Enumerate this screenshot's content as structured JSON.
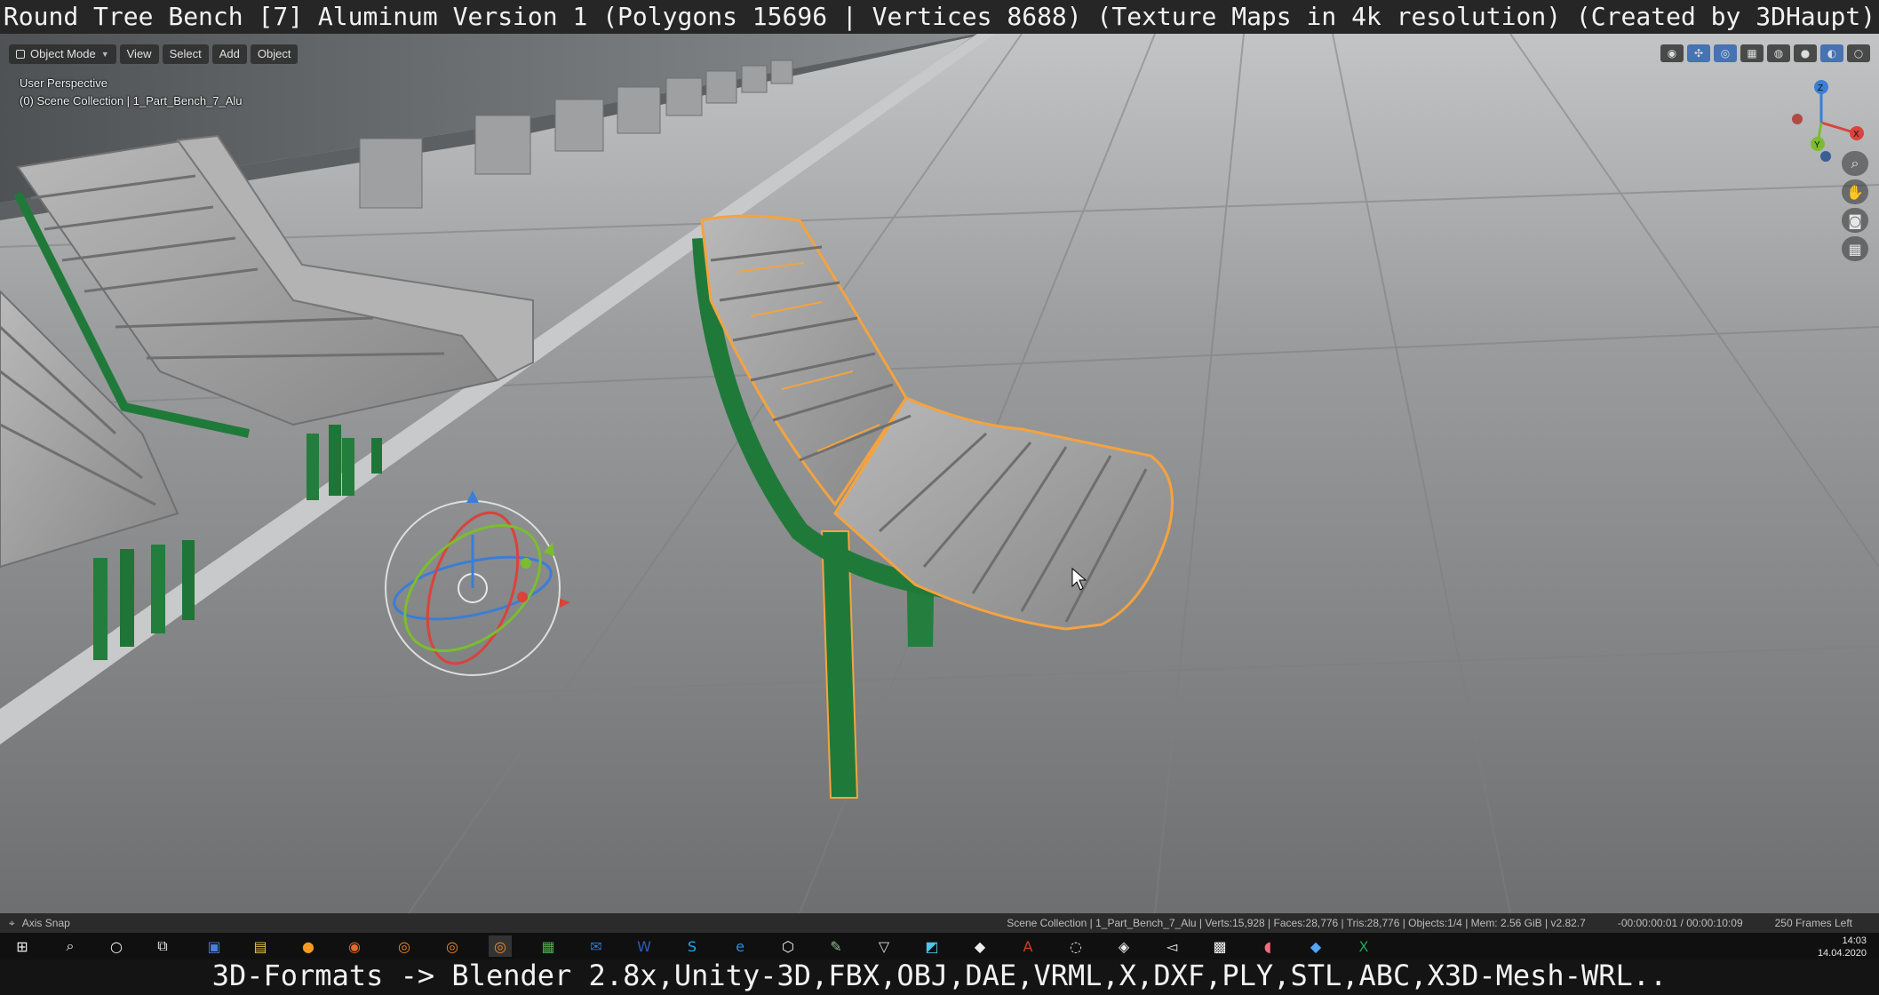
{
  "captions": {
    "top": "Round Tree Bench [7] Aluminum Version 1 (Polygons 15696 | Vertices 8688) (Texture Maps in 4k resolution) (Created by 3DHaupt)",
    "bottom": "3D-Formats -> Blender 2.8x,Unity-3D,FBX,OBJ,DAE,VRML,X,DXF,PLY,STL,ABC,X3D-Mesh-WRL.."
  },
  "header": {
    "mode": "Object Mode",
    "menus": [
      "View",
      "Select",
      "Add",
      "Object"
    ]
  },
  "viewport": {
    "perspective": "User Perspective",
    "collection": "(0) Scene Collection | 1_Part_Bench_7_Alu"
  },
  "gizmo": {
    "x": "X",
    "y": "Y",
    "z": "Z"
  },
  "status": {
    "left": "Axis Snap",
    "stats": "Scene Collection | 1_Part_Bench_7_Alu | Verts:15,928 | Faces:28,776 | Tris:28,776 | Objects:1/4 | Mem: 2.56 GiB | v2.82.7",
    "timer": "-00:00:00:01 / 00:00:10:09",
    "frames": "250 Frames Left"
  },
  "taskbar": {
    "time": "14:03",
    "date": "14.04.2020"
  },
  "colors": {
    "selection": "#f4a340",
    "frame": "#1f7a3a",
    "slat": "#a9a9a9",
    "accent": "#4772b3"
  }
}
